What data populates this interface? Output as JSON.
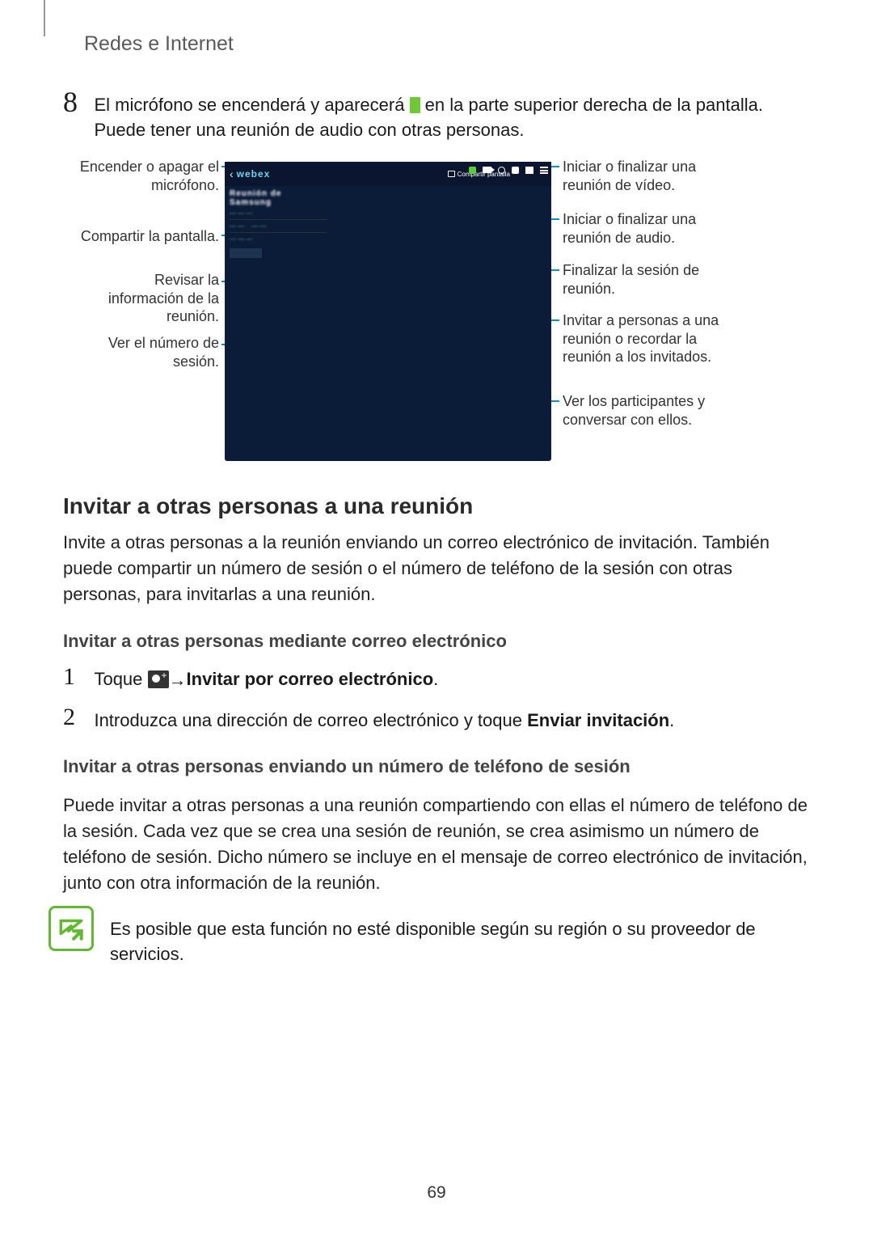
{
  "header": {
    "section": "Redes e Internet"
  },
  "step8": {
    "num": "8",
    "pre": "El micrófono se encenderá y aparecerá ",
    "post": " en la parte superior derecha de la pantalla. Puede tener una reunión de audio con otras personas."
  },
  "figure": {
    "brand": "webex",
    "share_label": "Compartir pantalla",
    "left_callouts": [
      "Encender o apagar el micrófono.",
      "Compartir la pantalla.",
      "Revisar la información de la reunión.",
      "Ver el número de sesión."
    ],
    "right_callouts": [
      "Iniciar o finalizar una reunión de vídeo.",
      "Iniciar o finalizar una reunión de audio.",
      "Finalizar la sesión de reunión.",
      "Invitar a personas a una reunión o recordar la reunión a los invitados.",
      "Ver los participantes y conversar con ellos."
    ]
  },
  "invite": {
    "heading": "Invitar a otras personas a una reunión",
    "para": "Invite a otras personas a la reunión enviando un correo electrónico de invitación. También puede compartir un número de sesión o el número de teléfono de la sesión con otras personas, para invitarlas a una reunión.",
    "sub_email": "Invitar a otras personas mediante correo electrónico",
    "step1_num": "1",
    "step1_pre": "Toque ",
    "step1_arrow": " → ",
    "step1_bold": "Invitar por correo electrónico",
    "step1_post": ".",
    "step2_num": "2",
    "step2_pre": "Introduzca una dirección de correo electrónico y toque ",
    "step2_bold": "Enviar invitación",
    "step2_post": ".",
    "sub_phone": "Invitar a otras personas enviando un número de teléfono de sesión",
    "para_phone": "Puede invitar a otras personas a una reunión compartiendo con ellas el número de teléfono de la sesión. Cada vez que se crea una sesión de reunión, se crea asimismo un número de teléfono de sesión. Dicho número se incluye en el mensaje de correo electrónico de invitación, junto con otra información de la reunión."
  },
  "note": "Es posible que esta función no esté disponible según su región o su proveedor de servicios.",
  "page_number": "69"
}
